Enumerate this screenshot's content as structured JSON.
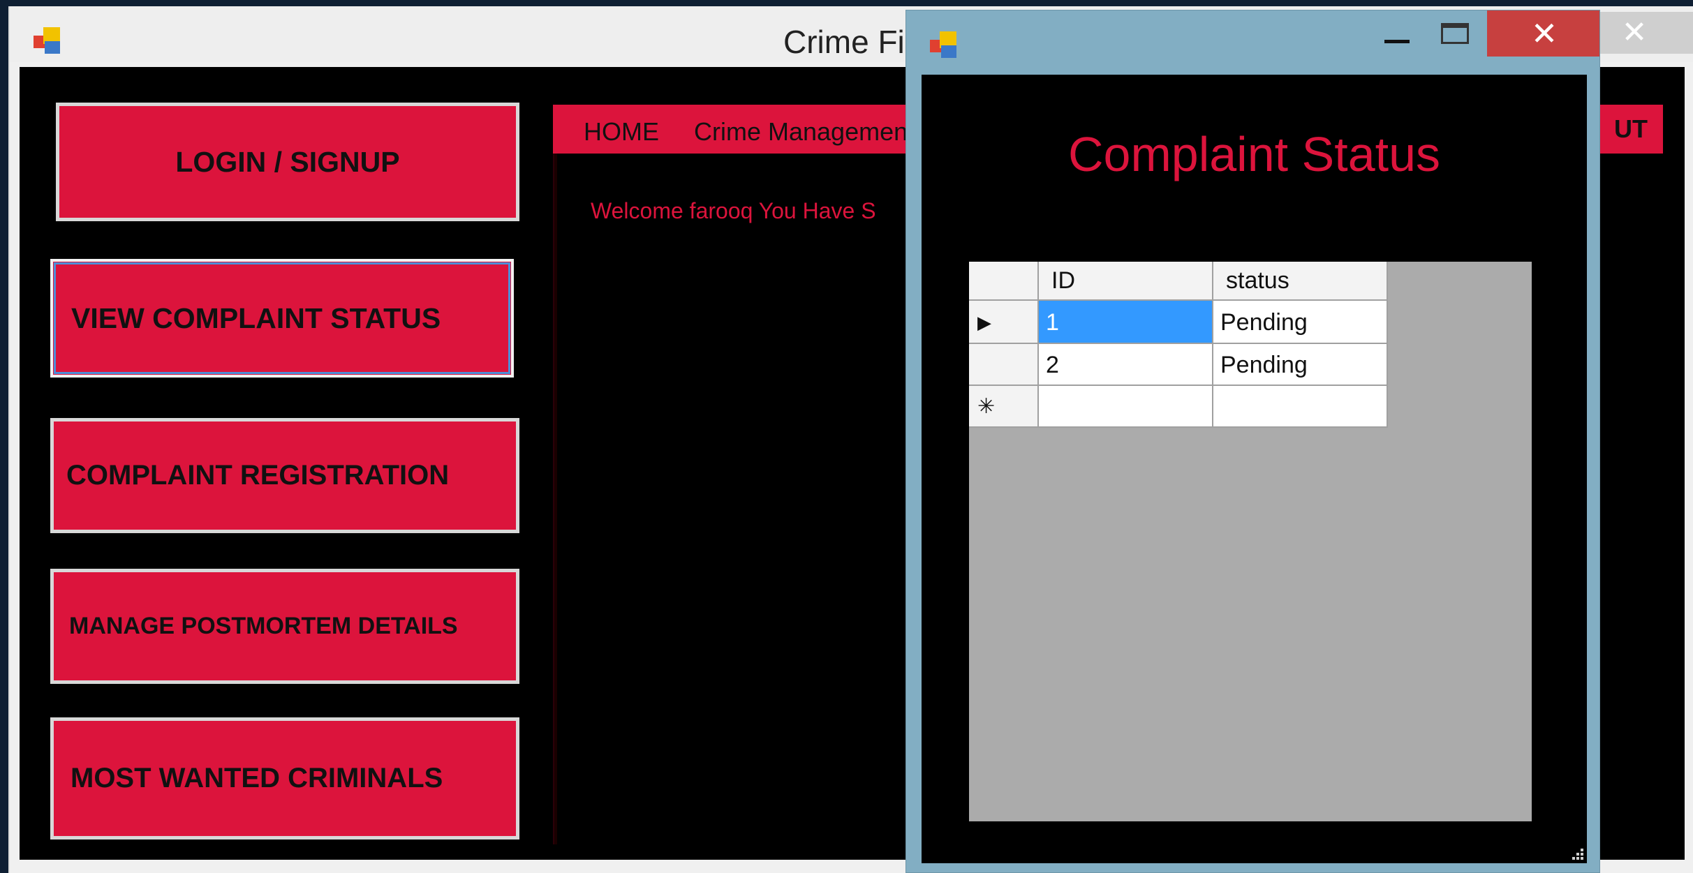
{
  "main_window": {
    "title": "Crime Fi",
    "close_glyph": "✕",
    "icon": "app-icon"
  },
  "sidebar": {
    "items": [
      {
        "label": "LOGIN / SIGNUP"
      },
      {
        "label": "VIEW COMPLAINT STATUS"
      },
      {
        "label": "COMPLAINT REGISTRATION"
      },
      {
        "label": "MANAGE POSTMORTEM DETAILS"
      },
      {
        "label": "MOST WANTED CRIMINALS"
      }
    ]
  },
  "menu": {
    "home": "HOME",
    "crime": "Crime Managemen",
    "logout": "UT"
  },
  "welcome_text": "Welcome farooq You Have S",
  "dialog": {
    "icon": "app-icon",
    "minimize_glyph": "—",
    "close_glyph": "✕",
    "title": "Complaint Status",
    "grid": {
      "columns": [
        "ID",
        "status"
      ],
      "rows": [
        {
          "marker": "▶",
          "id": "1",
          "status": "Pending",
          "selected": true
        },
        {
          "marker": "",
          "id": "2",
          "status": "Pending",
          "selected": false
        }
      ],
      "new_row_marker": "✳"
    }
  },
  "colors": {
    "accent": "#dc143c",
    "dialog_frame": "#82aec3",
    "selection": "#3399ff",
    "close_red": "#c7403f"
  }
}
